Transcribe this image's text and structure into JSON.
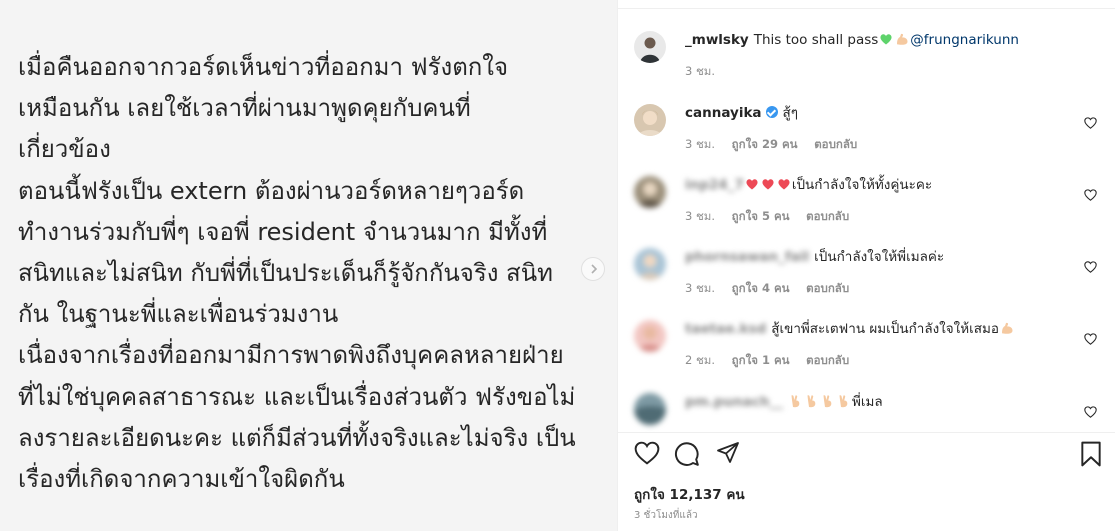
{
  "post": {
    "text_lines": [
      "เมื่อคืนออกจากวอร์ดเห็นข่าวที่ออกมา ฟรังตกใจ",
      "เหมือนกัน  เลยใช้เวลาที่ผ่านมาพูดคุยกับคนที่",
      "เกี่ยวข้อง",
      "ตอนนี้ฟรังเป็น extern ต้องผ่านวอร์ดหลายๆวอร์ด",
      "ทำงานร่วมกับพี่ๆ เจอพี่ resident จำนวนมาก มีทั้งที่",
      "สนิทและไม่สนิท กับพี่ที่เป็นประเด็นก็รู้จักกันจริง สนิท",
      "กัน  ในฐานะพี่และเพื่อนร่วมงาน",
      "เนื่องจากเรื่องที่ออกมามีการพาดพิงถึงบุคคลหลายฝ่าย",
      "ที่ไม่ใช่บุคคลสาธารณะ และเป็นเรื่องส่วนตัว ฟรังขอไม่",
      "ลงรายละเอียดนะคะ แต่ก็มีส่วนที่ทั้งจริงและไม่จริง เป็น",
      "เรื่องที่เกิดจากความเข้าใจผิดกัน"
    ]
  },
  "caption": {
    "username": "_mwlsky",
    "text": "This too shall pass",
    "mention": "@frungnarikunn",
    "time": "3 ชม."
  },
  "comments": [
    {
      "username": "cannayika",
      "verified": true,
      "text": "สู้ๆ",
      "time": "3 ชม.",
      "likes": "ถูกใจ 29 คน",
      "reply": "ตอบกลับ",
      "blurred": false
    },
    {
      "username": "inp24_7",
      "verified": false,
      "text": "เป็นกำลังใจให้ทั้งคู่นะคะ",
      "time": "3 ชม.",
      "likes": "ถูกใจ 5 คน",
      "reply": "ตอบกลับ",
      "blurred": true
    },
    {
      "username": "phornsawan_fail",
      "verified": false,
      "text": "เป็นกำลังใจให้พี่เมลค่ะ",
      "time": "3 ชม.",
      "likes": "ถูกใจ 4 คน",
      "reply": "ตอบกลับ",
      "blurred": true
    },
    {
      "username": "taetae.ksd",
      "verified": false,
      "text": "สู้เขาพี่สะเตฟาน ผมเป็นกำลังใจให้เสมอ",
      "time": "2 ชม.",
      "likes": "ถูกใจ 1 คน",
      "reply": "ตอบกลับ",
      "blurred": true
    },
    {
      "username": "pm.punach__",
      "verified": false,
      "text": "พี่เมล",
      "time": "",
      "likes": "",
      "reply": "",
      "blurred": true
    }
  ],
  "footer": {
    "likes": "ถูกใจ 12,137 คน",
    "time_ago": "3 ชั่วโมงที่แล้ว"
  },
  "colors": {
    "text": "#262626",
    "secondary": "#8e8e8e",
    "mention": "#00376b",
    "verified": "#3897f0",
    "emoji_heart_green": "#5ed36b",
    "emoji_heart_red": "#ed4956",
    "emoji_skin": "#f5c9a0"
  },
  "icons": [
    "next-arrow-icon",
    "heart-icon",
    "comment-icon",
    "share-icon",
    "bookmark-icon",
    "verified-badge-icon",
    "green-heart-emoji",
    "flexed-biceps-emoji",
    "red-heart-emoji",
    "victory-hand-emoji"
  ]
}
